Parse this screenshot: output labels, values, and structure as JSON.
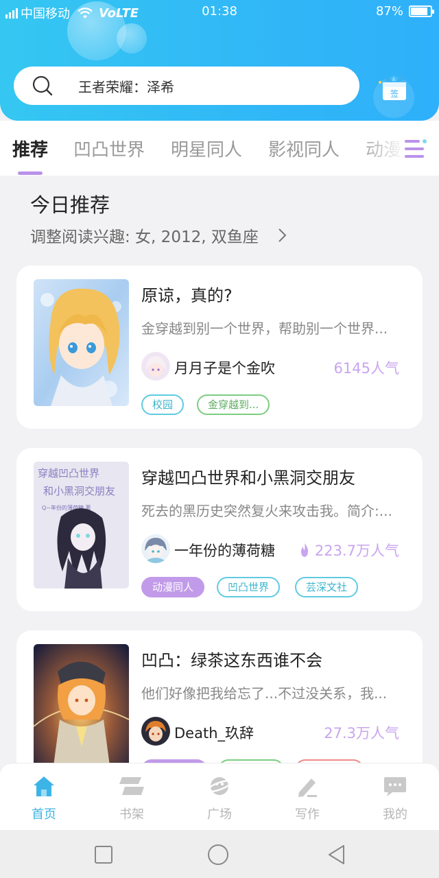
{
  "status_bar": {
    "carrier": "中国移动",
    "network": "VoLTE",
    "time": "01:38",
    "battery": "87%",
    "battery_level": 0.87
  },
  "search": {
    "text": "王者荣耀：泽希"
  },
  "gift_badge": "签",
  "tabs": [
    {
      "label": "推荐",
      "active": true
    },
    {
      "label": "凹凸世界",
      "active": false
    },
    {
      "label": "明星同人",
      "active": false
    },
    {
      "label": "影视同人",
      "active": false
    },
    {
      "label": "动漫",
      "active": false
    }
  ],
  "section": {
    "title": "今日推荐",
    "subtitle": "调整阅读兴趣: 女, 2012, 双鱼座"
  },
  "cards": [
    {
      "title": "原谅，真的?",
      "description": "金穿越到别一个世界，帮助别一个世界...",
      "author": "月月子是个金吹",
      "popularity": "6145人气",
      "hot": false,
      "tags": [
        {
          "label": "校园",
          "style": "cyan"
        },
        {
          "label": "金穿越到...",
          "style": "green"
        }
      ]
    },
    {
      "title": "穿越凹凸世界和小黑洞交朋友",
      "description": "死去的黑历史突然复火来攻击我。简介:...",
      "author": "一年份的薄荷糖",
      "popularity": "223.7万人气",
      "hot": true,
      "cover_text": [
        "穿越凹凸世界",
        "和小黑洞交朋友",
        "Q~年份的薄荷糖 著"
      ],
      "tags": [
        {
          "label": "动漫同人",
          "style": "purple"
        },
        {
          "label": "凹凸世界",
          "style": "cyan"
        },
        {
          "label": "芸深文社",
          "style": "cyan"
        }
      ]
    },
    {
      "title": "凹凸：绿茶这东西谁不会",
      "description": "他们好像把我给忘了...不过没关系，我...",
      "author": "Death_玖辞",
      "popularity": "27.3万人气",
      "hot": false,
      "tags": [
        {
          "label": "",
          "style": "purple"
        },
        {
          "label": "",
          "style": "green"
        },
        {
          "label": "",
          "style": "red"
        }
      ]
    }
  ],
  "bottom_nav": [
    {
      "label": "首页",
      "icon": "home-icon",
      "active": true
    },
    {
      "label": "书架",
      "icon": "bookshelf-icon",
      "active": false
    },
    {
      "label": "广场",
      "icon": "planet-icon",
      "active": false
    },
    {
      "label": "写作",
      "icon": "pen-icon",
      "active": false
    },
    {
      "label": "我的",
      "icon": "chat-bubble-icon",
      "active": false
    }
  ],
  "colors": {
    "header_start": "#35c7f2",
    "header_end": "#2fb0fa",
    "accent_purple": "#c19be9",
    "accent_blue": "#3db4e6"
  }
}
